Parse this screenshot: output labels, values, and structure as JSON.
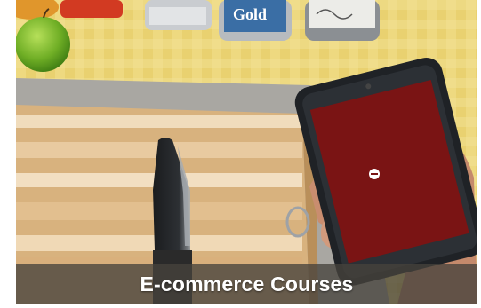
{
  "card": {
    "caption": "E-commerce Courses",
    "can_label": "Gold"
  },
  "colors": {
    "tablecloth": "#e9d170",
    "phone_screen": "#7a1414",
    "caption_bar": "#46423c",
    "caption_text": "#ffffff"
  },
  "icons": {
    "phone_center": "play-dot-icon"
  }
}
